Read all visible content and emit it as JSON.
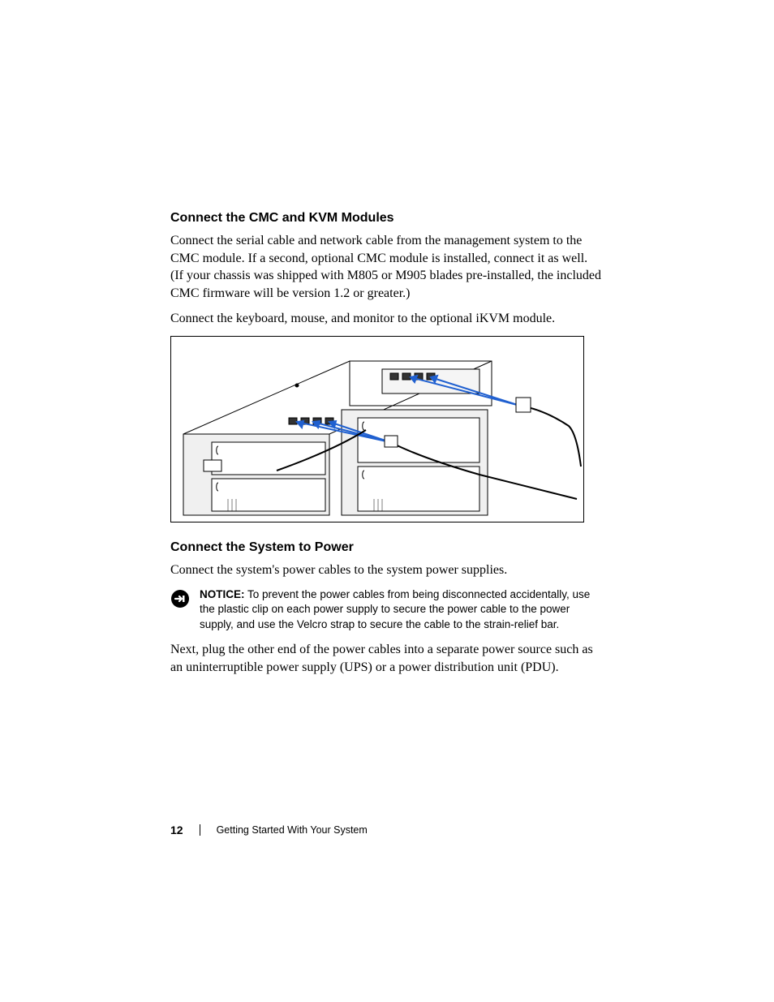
{
  "section1": {
    "heading": "Connect the CMC and KVM Modules",
    "para1": "Connect the serial cable and network cable from the management system to the CMC module. If a second, optional CMC module is installed, connect it as well. (If your chassis was shipped with M805 or M905 blades pre-installed, the included CMC firmware will be version 1.2 or greater.)",
    "para2": "Connect the keyboard, mouse, and monitor to the optional iKVM module."
  },
  "section2": {
    "heading": "Connect the System to Power",
    "para1": "Connect the system's power cables to the system power supplies.",
    "notice_label": "NOTICE:",
    "notice_text": " To prevent the power cables from being disconnected accidentally, use the plastic clip on each power supply to secure the power cable to the power supply, and use the Velcro strap to secure the cable to the strain-relief bar.",
    "para2": "Next, plug the other end of the power cables into a separate power source such as an uninterruptible power supply (UPS) or a power distribution unit (PDU)."
  },
  "footer": {
    "page_number": "12",
    "title": "Getting Started With Your System"
  }
}
